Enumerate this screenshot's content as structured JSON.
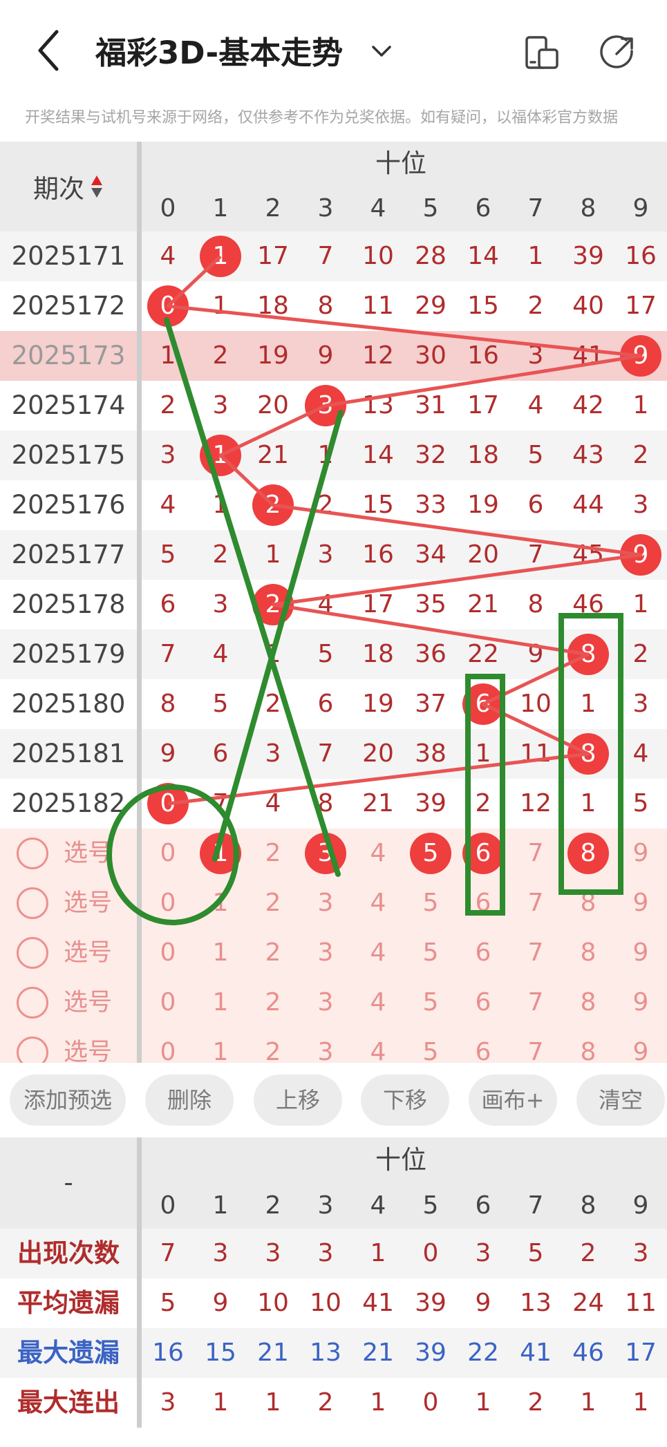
{
  "header": {
    "title": "福彩3D-基本走势"
  },
  "notice": "开奖结果与试机号来源于网络，仅供参考不作为兑奖依据。如有疑问，以福体彩官方数据",
  "table": {
    "period_header": "期次",
    "group_header": "十位",
    "columns": [
      "0",
      "1",
      "2",
      "3",
      "4",
      "5",
      "6",
      "7",
      "8",
      "9"
    ],
    "rows": [
      {
        "period": "2025171",
        "cells": [
          "4",
          "1",
          "17",
          "7",
          "10",
          "28",
          "14",
          "1",
          "39",
          "16"
        ],
        "hit": 1
      },
      {
        "period": "2025172",
        "cells": [
          "0",
          "1",
          "18",
          "8",
          "11",
          "29",
          "15",
          "2",
          "40",
          "17"
        ],
        "hit": 0
      },
      {
        "period": "2025173",
        "cells": [
          "1",
          "2",
          "19",
          "9",
          "12",
          "30",
          "16",
          "3",
          "41",
          "9"
        ],
        "hit": 9
      },
      {
        "period": "2025174",
        "cells": [
          "2",
          "3",
          "20",
          "3",
          "13",
          "31",
          "17",
          "4",
          "42",
          "1"
        ],
        "hit": 3
      },
      {
        "period": "2025175",
        "cells": [
          "3",
          "1",
          "21",
          "1",
          "14",
          "32",
          "18",
          "5",
          "43",
          "2"
        ],
        "hit": 1
      },
      {
        "period": "2025176",
        "cells": [
          "4",
          "1",
          "2",
          "2",
          "15",
          "33",
          "19",
          "6",
          "44",
          "3"
        ],
        "hit": 2
      },
      {
        "period": "2025177",
        "cells": [
          "5",
          "2",
          "1",
          "3",
          "16",
          "34",
          "20",
          "7",
          "45",
          "9"
        ],
        "hit": 9
      },
      {
        "period": "2025178",
        "cells": [
          "6",
          "3",
          "2",
          "4",
          "17",
          "35",
          "21",
          "8",
          "46",
          "1"
        ],
        "hit": 2
      },
      {
        "period": "2025179",
        "cells": [
          "7",
          "4",
          "1",
          "5",
          "18",
          "36",
          "22",
          "9",
          "8",
          "2"
        ],
        "hit": 8
      },
      {
        "period": "2025180",
        "cells": [
          "8",
          "5",
          "2",
          "6",
          "19",
          "37",
          "6",
          "10",
          "1",
          "3"
        ],
        "hit": 6
      },
      {
        "period": "2025181",
        "cells": [
          "9",
          "6",
          "3",
          "7",
          "20",
          "38",
          "1",
          "11",
          "8",
          "4"
        ],
        "hit": 8
      },
      {
        "period": "2025182",
        "cells": [
          "0",
          "7",
          "4",
          "8",
          "21",
          "39",
          "2",
          "12",
          "1",
          "5"
        ],
        "hit": 0
      }
    ],
    "pick_rows": [
      {
        "label": "选号",
        "cells": [
          "0",
          "1",
          "2",
          "3",
          "4",
          "5",
          "6",
          "7",
          "8",
          "9"
        ],
        "selected": [
          1,
          3,
          5,
          6,
          8
        ]
      },
      {
        "label": "选号",
        "cells": [
          "0",
          "1",
          "2",
          "3",
          "4",
          "5",
          "6",
          "7",
          "8",
          "9"
        ],
        "selected": []
      },
      {
        "label": "选号",
        "cells": [
          "0",
          "1",
          "2",
          "3",
          "4",
          "5",
          "6",
          "7",
          "8",
          "9"
        ],
        "selected": []
      },
      {
        "label": "选号",
        "cells": [
          "0",
          "1",
          "2",
          "3",
          "4",
          "5",
          "6",
          "7",
          "8",
          "9"
        ],
        "selected": []
      },
      {
        "label": "选号",
        "cells": [
          "0",
          "1",
          "2",
          "3",
          "4",
          "5",
          "6",
          "7",
          "8",
          "9"
        ],
        "selected": []
      }
    ]
  },
  "buttons": [
    "添加预选",
    "删除",
    "上移",
    "下移",
    "画布+",
    "清空"
  ],
  "stats": {
    "dash": "-",
    "group_header": "十位",
    "columns": [
      "0",
      "1",
      "2",
      "3",
      "4",
      "5",
      "6",
      "7",
      "8",
      "9"
    ],
    "rows": [
      {
        "label": "出现次数",
        "color": "#b02c2c",
        "values": [
          "7",
          "3",
          "3",
          "3",
          "1",
          "0",
          "3",
          "5",
          "2",
          "3"
        ]
      },
      {
        "label": "平均遗漏",
        "color": "#b02c2c",
        "values": [
          "5",
          "9",
          "10",
          "10",
          "41",
          "39",
          "9",
          "13",
          "24",
          "11"
        ]
      },
      {
        "label": "最大遗漏",
        "color": "#3a63c4",
        "values": [
          "16",
          "15",
          "21",
          "13",
          "21",
          "39",
          "22",
          "41",
          "46",
          "17"
        ]
      },
      {
        "label": "最大连出",
        "color": "#b02c2c",
        "values": [
          "3",
          "1",
          "1",
          "2",
          "1",
          "0",
          "1",
          "2",
          "1",
          "1"
        ]
      }
    ]
  },
  "colors": {
    "hit_ball": "#ee3e3e",
    "trend_line": "#e85454",
    "annotation": "#2e8b2e",
    "highlight_row": "#f6cfcf",
    "pick_bg": "#fdece7"
  }
}
